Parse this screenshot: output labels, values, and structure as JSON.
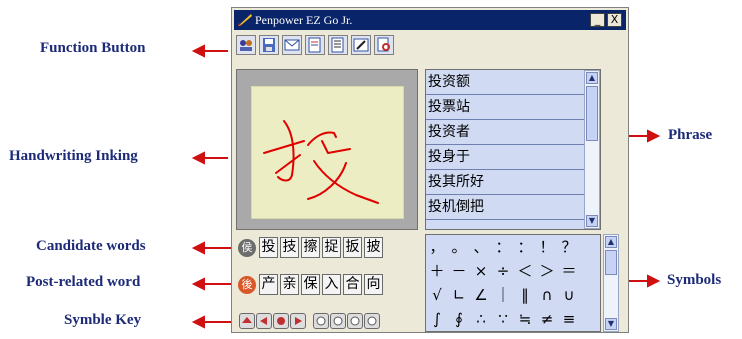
{
  "callouts": {
    "function_button": "Function Button",
    "handwriting_inking": "Handwriting Inking",
    "candidate_words": "Candidate words",
    "post_related_word": "Post-related word",
    "symble_key": "Symble Key",
    "phrase": "Phrase",
    "symbols": "Symbols"
  },
  "window": {
    "title": "Penpower EZ Go Jr.",
    "minimize": "_",
    "close": "X"
  },
  "toolbar": [
    "people-icon",
    "save-icon",
    "mail-icon",
    "document-icon",
    "list-icon",
    "edit-icon",
    "lookup-icon"
  ],
  "phrases": [
    "投资额",
    "投票站",
    "投资者",
    "投身于",
    "投其所好",
    "投机倒把"
  ],
  "candidates": {
    "badge": "侯",
    "words": [
      "投",
      "技",
      "擦",
      "捉",
      "扳",
      "披"
    ]
  },
  "related": {
    "badge": "後",
    "words": [
      "产",
      "亲",
      "保",
      "入",
      "合",
      "向"
    ]
  },
  "symbol_keys": [
    "key-1",
    "key-2",
    "key-3",
    "key-4",
    "key-5",
    "key-6",
    "key-7",
    "key-8"
  ],
  "symbols": [
    "，",
    "。",
    "、",
    "：",
    "：",
    "！",
    "？",
    "",
    "＋",
    "－",
    "×",
    "÷",
    "＜",
    "＞",
    "＝",
    "",
    "√",
    "∟",
    "∠",
    "｜",
    "‖",
    "∩",
    "∪",
    "",
    "∫",
    "∮",
    "∴",
    "∵",
    "≒",
    "≠",
    "≡",
    ""
  ],
  "colors": {
    "callout_text": "#1c2a78",
    "arrow": "#d01010",
    "titlebar": "#0a246a",
    "ink": "#e00000",
    "list_bg": "#d0daf3"
  }
}
